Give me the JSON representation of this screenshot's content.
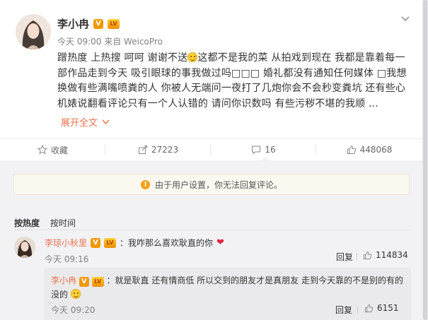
{
  "post": {
    "author": "李小冉",
    "verified_badge": "V",
    "level_badge": "LV",
    "time": "今天 09:00",
    "source": "来自 WeicoPro",
    "text_part1": "蹭热度 上热搜 呵呵 谢谢不送",
    "text_part2": "这都不是我的菜 从拍戏到现在 我都是靠着每一部作品走到今天 吸引眼球的事我做过吗□□□ 婚礼都没有通知任何媒体 □我想换做有些满嘴喷粪的人 你被人无端问一夜打了几炮你会不会秒变粪坑 还有些心机婊说翻看评论只有一个人认错的 请问你识数吗 有些污秽不堪的我顺 ...",
    "expand_label": "展开全文",
    "emoji_icon": "smile-emoji-icon"
  },
  "actions": {
    "favorite_label": "收藏",
    "share_count": "27223",
    "comment_count": "16",
    "like_count": "448068"
  },
  "comments": {
    "notice": "由于用户设置，你无法回复评论。",
    "sort_hot": "按热度",
    "sort_time": "按时间",
    "first": {
      "user": "李琼小秋里",
      "text": "：我咋那么喜欢耿直的你",
      "heart": "❤",
      "time": "今天 09:16",
      "reply_label": "回复",
      "like_count": "114834"
    },
    "sub": {
      "user": "李小冉",
      "text": "：就是耿直 还有情商低 所以交到的朋友才是真朋友 走到今天靠的不是别的有的没的",
      "time": "今天 09:20",
      "reply_label": "回复",
      "like_count": "6151"
    }
  },
  "colors": {
    "accent_orange": "#eb7350",
    "notice_icon": "#f5a01a",
    "verified": "#f39800",
    "heart": "#e0243b"
  }
}
